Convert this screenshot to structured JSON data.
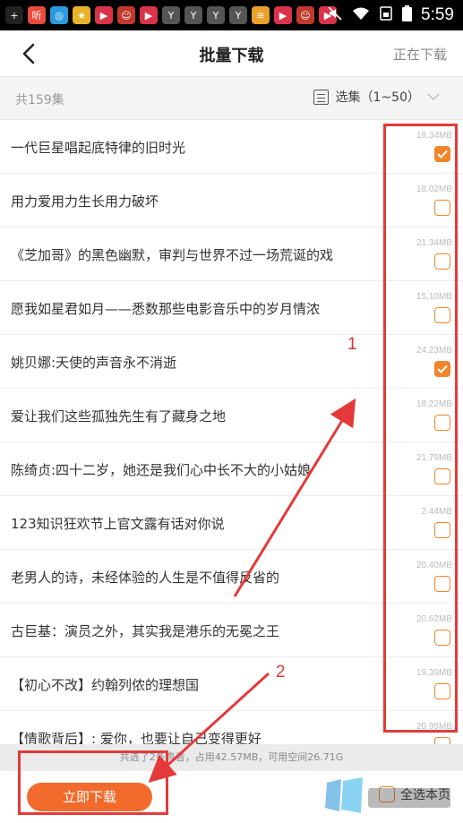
{
  "status_bar": {
    "icons": [
      {
        "name": "add-icon",
        "glyph": "+",
        "color": "#222222"
      },
      {
        "name": "ting-app-icon",
        "glyph": "听",
        "color": "#e84c3d"
      },
      {
        "name": "circle-app-icon",
        "glyph": "◎",
        "color": "#2b9be0"
      },
      {
        "name": "star-app-icon",
        "glyph": "★",
        "color": "#e8b32b"
      },
      {
        "name": "video-app-icon",
        "glyph": "▶",
        "color": "#d9344a"
      },
      {
        "name": "avatar-app-icon",
        "glyph": "☺",
        "color": "#c0392b"
      },
      {
        "name": "video-app-icon",
        "glyph": "▶",
        "color": "#d9344a"
      },
      {
        "name": "y-app-icon",
        "glyph": "Y",
        "color": "#555555"
      },
      {
        "name": "y-app-icon",
        "glyph": "Y",
        "color": "#555555"
      },
      {
        "name": "y-app-icon",
        "glyph": "Y",
        "color": "#555555"
      },
      {
        "name": "y-app-icon",
        "glyph": "Y",
        "color": "#555555"
      },
      {
        "name": "wifi-app-icon",
        "glyph": "≋",
        "color": "#e8a12b"
      },
      {
        "name": "video-app-icon",
        "glyph": "▶",
        "color": "#d9344a"
      },
      {
        "name": "avatar-app-icon",
        "glyph": "☺",
        "color": "#c0392b"
      },
      {
        "name": "video-app-icon",
        "glyph": "▶",
        "color": "#d9344a"
      }
    ],
    "time": "5:59"
  },
  "header": {
    "title": "批量下载",
    "right_link": "正在下载"
  },
  "summary": {
    "total": "共159集",
    "range_label": "选集（1~50）"
  },
  "episodes": [
    {
      "title": "一代巨星唱起底特律的旧时光",
      "size": "18.34MB",
      "checked": true
    },
    {
      "title": "用力爱用力生长用力破坏",
      "size": "18.02MB",
      "checked": false
    },
    {
      "title": "《芝加哥》的黑色幽默，审判与世界不过一场荒诞的戏",
      "size": "21.34MB",
      "checked": false
    },
    {
      "title": "愿我如星君如月——悉数那些电影音乐中的岁月情浓",
      "size": "15.10MB",
      "checked": false
    },
    {
      "title": "姚贝娜:天使的声音永不消逝",
      "size": "24.23MB",
      "checked": true
    },
    {
      "title": "爱让我们这些孤独先生有了藏身之地",
      "size": "18.22MB",
      "checked": false
    },
    {
      "title": "陈绮贞:四十二岁，她还是我们心中长不大的小姑娘",
      "size": "21.79MB",
      "checked": false
    },
    {
      "title": "123知识狂欢节上官文露有话对你说",
      "size": "2.44MB",
      "checked": false
    },
    {
      "title": "老男人的诗，未经体验的人生是不值得反省的",
      "size": "20.40MB",
      "checked": false
    },
    {
      "title": "古巨基：演员之外，其实我是港乐的无冕之王",
      "size": "20.62MB",
      "checked": false
    },
    {
      "title": "【初心不改】约翰列侬的理想国",
      "size": "19.39MB",
      "checked": false
    },
    {
      "title": "【情歌背后】: 爱你，也要让自己变得更好",
      "size": "20.95MB",
      "checked": false
    }
  ],
  "bottom": {
    "status_text": "共选了2条声音，占用42.57MB，可用空间26.71G",
    "download_button": "立即下载",
    "select_all": "全选本页"
  },
  "annotations": {
    "label_1": "1",
    "label_2": "2",
    "color": "#e53a3a"
  },
  "colors": {
    "accent": "#f26b2c",
    "checkbox": "#f2852a"
  }
}
